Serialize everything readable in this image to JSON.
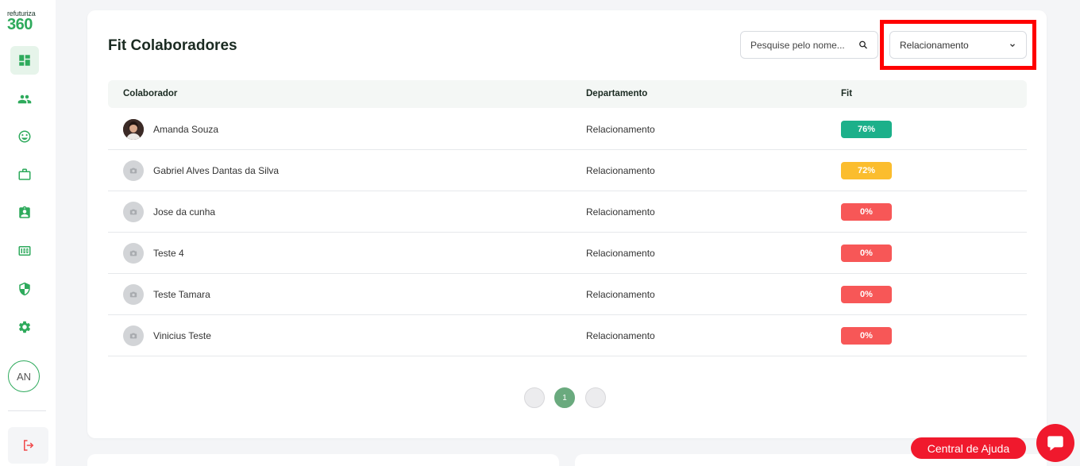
{
  "logo": {
    "small": "refuturiza",
    "big": "360"
  },
  "sidebar": {
    "items": [
      {
        "name": "dashboard-icon",
        "active": true
      },
      {
        "name": "people-icon"
      },
      {
        "name": "smile-icon"
      },
      {
        "name": "briefcase-icon"
      },
      {
        "name": "clipboard-user-icon"
      },
      {
        "name": "score-icon"
      },
      {
        "name": "shield-icon"
      },
      {
        "name": "gear-icon"
      }
    ],
    "user_initials": "AN",
    "logout_icon": "logout-icon"
  },
  "main": {
    "title": "Fit Colaboradores",
    "search": {
      "placeholder": "Pesquise pelo nome...",
      "value": ""
    },
    "department_filter": {
      "selected": "Relacionamento"
    },
    "table": {
      "headers": {
        "name": "Colaborador",
        "department": "Departamento",
        "fit": "Fit"
      },
      "rows": [
        {
          "name": "Amanda Souza",
          "department": "Relacionamento",
          "fit": "76%",
          "avatar": "photo"
        },
        {
          "name": "Gabriel Alves Dantas da Silva",
          "department": "Relacionamento",
          "fit": "72%",
          "avatar": "placeholder"
        },
        {
          "name": "Jose da cunha",
          "department": "Relacionamento",
          "fit": "0%",
          "avatar": "placeholder"
        },
        {
          "name": "Teste 4",
          "department": "Relacionamento",
          "fit": "0%",
          "avatar": "placeholder"
        },
        {
          "name": "Teste Tamara",
          "department": "Relacionamento",
          "fit": "0%",
          "avatar": "placeholder"
        },
        {
          "name": "Vinicius Teste",
          "department": "Relacionamento",
          "fit": "0%",
          "avatar": "placeholder"
        }
      ]
    },
    "pagination": {
      "current": "1"
    }
  },
  "help": {
    "label": "Central de Ajuda"
  },
  "colors": {
    "brand_green": "#2eaa5c",
    "fit_high": "#1cb08a",
    "fit_mid": "#fbbd2e",
    "fit_low": "#f75757",
    "help_red": "#f0192d",
    "highlight_red": "#ff0000"
  }
}
